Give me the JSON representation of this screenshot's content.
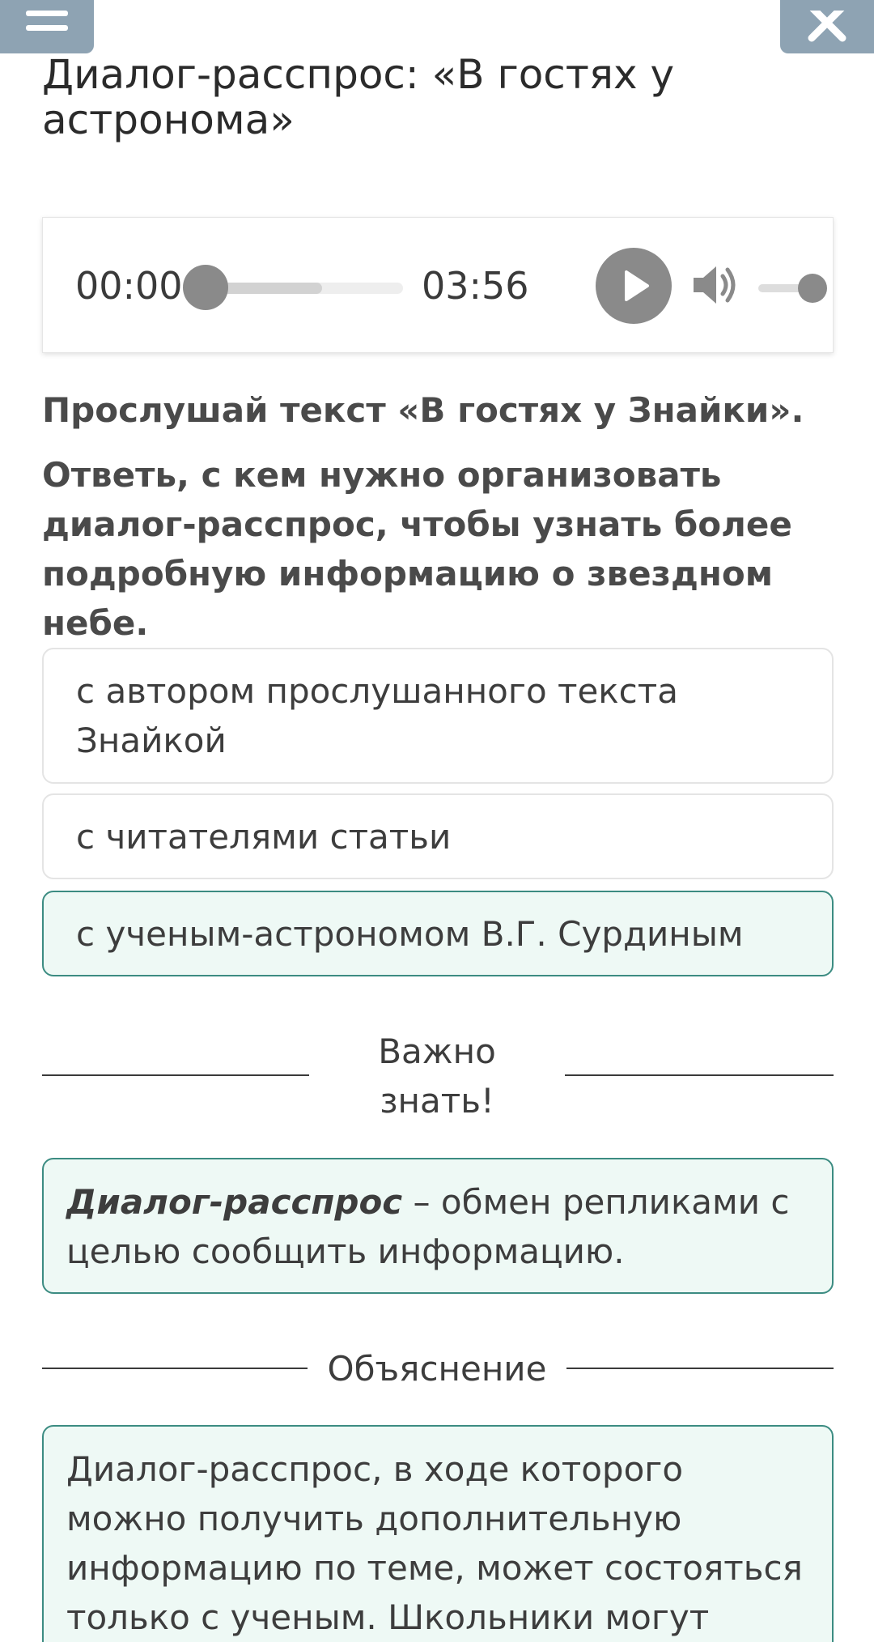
{
  "header": {
    "menu_icon": "hamburger-menu-icon",
    "close_icon": "close-x-icon",
    "title": "Диалог-расспрос: «В гостях у астронома»"
  },
  "player": {
    "current_time": "00:00",
    "total_time": "03:56",
    "progress": 0,
    "buffered": 0.6,
    "volume": 1.0
  },
  "question": {
    "instruction": "Прослушай текст «В гостях у Знайки».",
    "prompt": "Ответь, с кем нужно организовать диалог-расспрос, чтобы узнать более подробную информацию о звездном небе."
  },
  "options": [
    {
      "label": "с автором прослушанного текста Знайкой",
      "selected": false
    },
    {
      "label": "с читателями статьи",
      "selected": false
    },
    {
      "label": "с ученым-астрономом В.Г. Сурдиным",
      "selected": true
    }
  ],
  "important": {
    "label": "Важно знать!",
    "term": "Диалог-расспрос",
    "definition": " – обмен репликами с целью сообщить информацию."
  },
  "explanation": {
    "label": "Объяснение",
    "text": "Диалог-расспрос, в ходе которого можно получить дополнительную информацию по теме, может состояться только с ученым. Школьники могут узнать"
  },
  "colors": {
    "accent": "#3c8c82",
    "accent_bg": "#eef9f5",
    "control_gray": "#8a8a8a",
    "top_button": "#8ea3b3"
  }
}
